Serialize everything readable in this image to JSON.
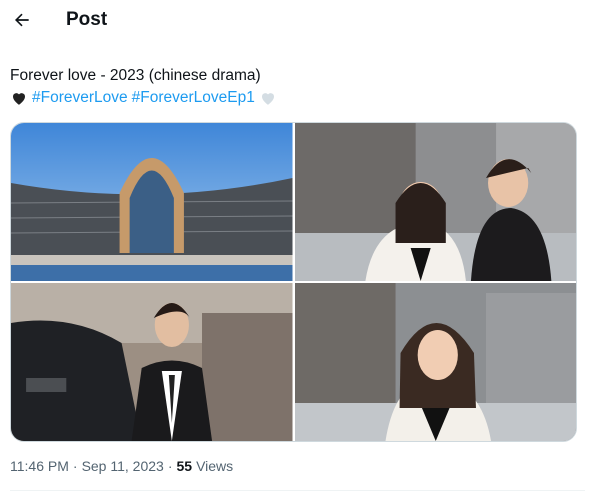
{
  "header": {
    "title": "Post",
    "back_icon": "arrow-left-icon"
  },
  "tweet": {
    "text_line1": "Forever love - 2023 (chinese drama)",
    "hashtag1": "#ForeverLove",
    "hashtag2": "#ForeverLoveEp1",
    "emoji_left": "black-heart-icon",
    "emoji_right": "white-heart-icon"
  },
  "media": [
    {
      "label": "building-photo"
    },
    {
      "label": "couple-photo"
    },
    {
      "label": "man-car-photo"
    },
    {
      "label": "woman-photo"
    }
  ],
  "meta": {
    "time": "11:46 PM",
    "separator": "·",
    "date": "Sep 11, 2023",
    "views_count": "55",
    "views_label": "Views"
  },
  "colors": {
    "accent": "#1d9bf0",
    "text": "#0f1419",
    "muted": "#536471"
  }
}
